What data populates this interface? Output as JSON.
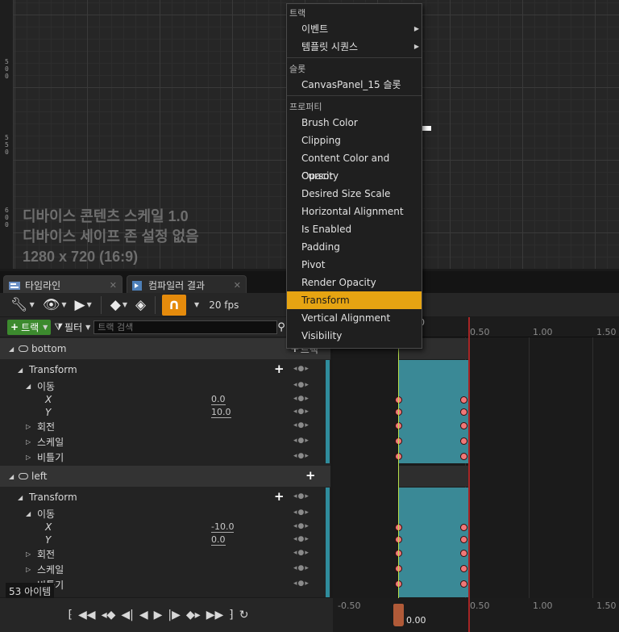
{
  "viewport": {
    "ruler_labels": [
      "500",
      "550",
      "600"
    ],
    "device_info": [
      "디바이스 콘텐츠 스케일 1.0",
      "디바이스 세이프 존 설정 없음",
      "1280 x 720 (16:9)"
    ]
  },
  "tabs": [
    {
      "label": "타임라인",
      "active": true
    },
    {
      "label": "컴파일러 결과",
      "active": false
    }
  ],
  "toolbar": {
    "fps": "20 fps"
  },
  "filter": {
    "add_track": "트랙",
    "filter_label": "필터",
    "search_placeholder": "트랙 검색"
  },
  "outliner": {
    "bottom_label": "bottom",
    "bottom_track_btn": "트랙",
    "transform_label": "Transform",
    "move_label": "이동",
    "x_label": "X",
    "y_label": "Y",
    "rotate_label": "회전",
    "scale_label": "스케일",
    "shear_label": "비틀기",
    "left_label": "left",
    "bottom_x": "0.0",
    "bottom_y": "10.0",
    "left_x": "-10.0",
    "left_y": "0.0",
    "item_count": "53 아이템"
  },
  "timeline": {
    "top_ticks": [
      "0.50",
      "1.00",
      "1.50"
    ],
    "top_partial": "0",
    "bottom_ticks": [
      "-0.50",
      "0.50",
      "1.00",
      "1.50"
    ],
    "playhead_value": "0.00"
  },
  "context_menu": {
    "sections": {
      "track": "트랙",
      "slot": "슬롯",
      "property": "프로퍼티"
    },
    "track_items": [
      "이벤트",
      "템플릿 시퀀스"
    ],
    "slot_items": [
      "CanvasPanel_15 슬롯"
    ],
    "property_items": [
      "Brush Color",
      "Clipping",
      "Content Color and Opacity",
      "Cursor",
      "Desired Size Scale",
      "Horizontal Alignment",
      "Is Enabled",
      "Padding",
      "Pivot",
      "Render Opacity",
      "Transform",
      "Vertical Alignment",
      "Visibility"
    ],
    "highlighted_item": "Transform"
  },
  "colors": {
    "accent_orange": "#e58b0c",
    "menu_highlight": "#e6a412",
    "section_teal": "#3a8996",
    "keyframe": "#f07878",
    "add_green": "#3c8a2e"
  }
}
